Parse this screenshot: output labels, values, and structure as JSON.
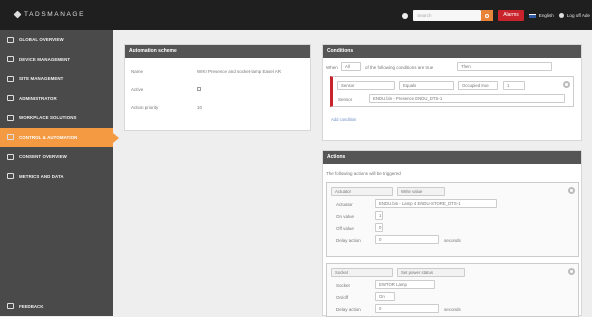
{
  "app": {
    "title": "TADSMANAGE",
    "search": "Search",
    "alarms": "Alarms",
    "language": "English",
    "logout": "Log off Ade"
  },
  "sidebar": {
    "items": [
      {
        "label": "Global overview",
        "active": false
      },
      {
        "label": "Device management",
        "active": false
      },
      {
        "label": "Site management",
        "active": false
      },
      {
        "label": "Administrator",
        "active": false
      },
      {
        "label": "Workplace solutions",
        "active": false
      },
      {
        "label": "Control & automation",
        "active": true
      },
      {
        "label": "Consent overview",
        "active": false
      },
      {
        "label": "Metrics and data",
        "active": false
      }
    ],
    "footer": "Feedback"
  },
  "schedule": {
    "title": "Automation scheme",
    "name_label": "Name",
    "name_value": "WIKI Presence and socket-lamp Easel AR",
    "active_label": "Active",
    "priority_label": "Action priority",
    "priority_value": "10"
  },
  "conditions": {
    "title": "Conditions",
    "when": "When",
    "all": "All",
    "rule_text": "of the following conditions are true",
    "then": "Then",
    "status": "Sensor",
    "equals": "Equals",
    "value": "Occupied true",
    "number": "1",
    "source_label": "Sensor",
    "source_value": "ENDU.bin - Presence ENDU_DTS-1",
    "add": "Add condition"
  },
  "actions": {
    "title": "Actions",
    "subtitle": "The following actions will be triggered",
    "a1": {
      "type": "Actuator",
      "mode": "Write value",
      "actuator_label": "Actuator",
      "actuator_value": "ENDU.bin - Lamp 4 ENDU-STORE_DTS-1",
      "on_label": "On value",
      "on_value": "1",
      "off_label": "Off value",
      "off_value": "0",
      "delay_label": "Delay action",
      "delay_value": "0",
      "delay_unit": "seconds"
    },
    "a2": {
      "type": "Socket",
      "mode": "Set power status",
      "socket_label": "Socket",
      "socket_value": "EWTOR Lamp",
      "on_off_label": "On/off",
      "on_off_value": "On",
      "delay_label": "Delay action",
      "delay_value": "0",
      "delay_unit": "seconds"
    }
  }
}
